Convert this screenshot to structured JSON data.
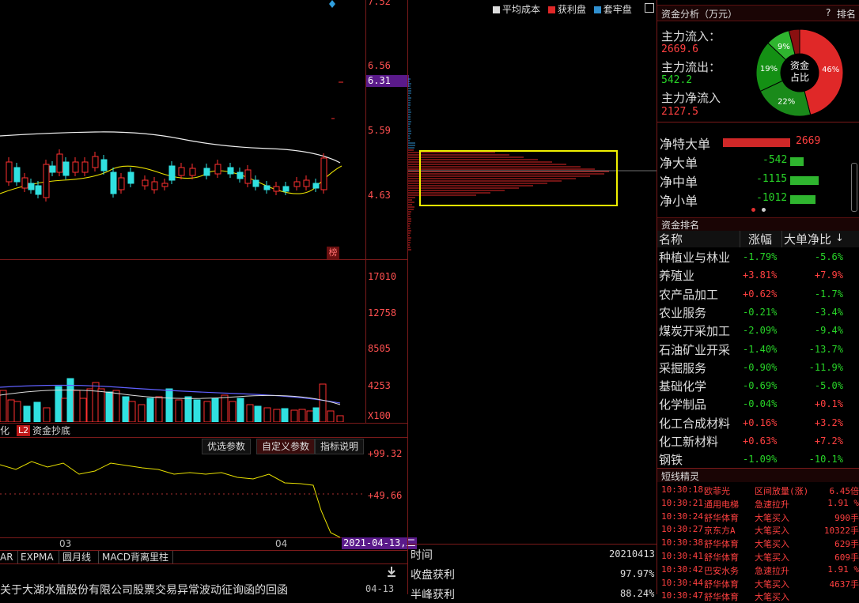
{
  "price_axis": [
    "7.52",
    "6.56",
    "6.31",
    "5.59",
    "4.63"
  ],
  "volume_axis": [
    "17010",
    "12758",
    "8505",
    "4253",
    "X100"
  ],
  "indicator_axis": [
    "+99.32",
    "+49.66"
  ],
  "month_labels": [
    "03",
    "04"
  ],
  "date_badge": "2021-04-13,二",
  "rank_badge": "榜",
  "indicator_tabs": {
    "prev": "化",
    "l2": "L2",
    "current": "资金抄底"
  },
  "param_buttons": {
    "preferred": "优选参数",
    "custom": "自定义参数",
    "explain": "指标说明"
  },
  "bottom_tabs": [
    "AR",
    "EXPMA",
    "圆月线",
    "MACD背离里柱"
  ],
  "news": {
    "title": "关于大湖水殖股份有限公司股票交易异常波动征询函的回函",
    "date": "04-13"
  },
  "chip": {
    "legend": {
      "avg_cost": "平均成本",
      "profit": "获利盘",
      "trapped": "套牢盘"
    },
    "time_label": "时间",
    "time_value": "20210413",
    "profit_label": "收盘获利",
    "profit_value": "97.97%",
    "next_label": "半峰获利",
    "next_value": "88.24%"
  },
  "fund": {
    "title": "资金分析（万元）",
    "help": "?",
    "rank_link": "排名",
    "inflow_label": "主力流入：",
    "inflow_value": "2669.6",
    "outflow_label": "主力流出：",
    "outflow_value": "542.2",
    "net_label": "主力净流入",
    "net_value": "2127.5",
    "donut_center": "资金\n占比",
    "donut_center_1": "资金",
    "donut_center_2": "占比",
    "pie": [
      {
        "label": "46%",
        "value": 46,
        "color": "#e02828"
      },
      {
        "label": "22%",
        "value": 22,
        "color": "#1a8a1a"
      },
      {
        "label": "19%",
        "value": 19,
        "color": "#149014"
      },
      {
        "label": "9%",
        "value": 9,
        "color": "#2fb52f"
      },
      {
        "label": "",
        "value": 4,
        "color": "#8a1010"
      }
    ]
  },
  "net_flow": [
    {
      "label": "净特大单",
      "value": "2669",
      "color": "#d02828",
      "bar": 1.0
    },
    {
      "label": "净大单",
      "value": "-542",
      "color": "#2fb52f",
      "bar": 0.2
    },
    {
      "label": "净中单",
      "value": "-1115",
      "color": "#2fb52f",
      "bar": 0.42
    },
    {
      "label": "净小单",
      "value": "-1012",
      "color": "#2fb52f",
      "bar": 0.38
    }
  ],
  "ranking": {
    "title": "资金排名",
    "headers": [
      "名称",
      "涨幅",
      "大单净比"
    ],
    "rows": [
      {
        "name": "种植业与林业",
        "chg": "-1.79%",
        "net": "-5.6%"
      },
      {
        "name": "养殖业",
        "chg": "+3.81%",
        "net": "+7.9%"
      },
      {
        "name": "农产品加工",
        "chg": "+0.62%",
        "net": "-1.7%"
      },
      {
        "name": "农业服务",
        "chg": "-0.21%",
        "net": "-3.4%"
      },
      {
        "name": "煤炭开采加工",
        "chg": "-2.09%",
        "net": "-9.4%"
      },
      {
        "name": "石油矿业开采",
        "chg": "-1.40%",
        "net": "-13.7%"
      },
      {
        "name": "采掘服务",
        "chg": "-0.90%",
        "net": "-11.9%"
      },
      {
        "name": "基础化学",
        "chg": "-0.69%",
        "net": "-5.0%"
      },
      {
        "name": "化学制品",
        "chg": "-0.04%",
        "net": "+0.1%"
      },
      {
        "name": "化工合成材料",
        "chg": "+0.16%",
        "net": "+3.2%"
      },
      {
        "name": "化工新材料",
        "chg": "+0.63%",
        "net": "+7.2%"
      },
      {
        "name": "钢铁",
        "chg": "-1.09%",
        "net": "-10.1%"
      }
    ]
  },
  "shortline": {
    "title": "短线精灵",
    "rows": [
      {
        "time": "10:30:18",
        "stock": "欧菲光",
        "event": "区间放量(涨)",
        "val": "6.45倍"
      },
      {
        "time": "10:30:21",
        "stock": "通用电梯",
        "event": "急速拉升",
        "val": "1.91 %"
      },
      {
        "time": "10:30:24",
        "stock": "舒华体育",
        "event": "大笔买入",
        "val": "990手"
      },
      {
        "time": "10:30:27",
        "stock": "京东方A",
        "event": "大笔买入",
        "val": "10322手"
      },
      {
        "time": "10:30:38",
        "stock": "舒华体育",
        "event": "大笔买入",
        "val": "629手"
      },
      {
        "time": "10:30:41",
        "stock": "舒华体育",
        "event": "大笔买入",
        "val": "609手"
      },
      {
        "time": "10:30:42",
        "stock": "巴安水务",
        "event": "急速拉升",
        "val": "1.91 %"
      },
      {
        "time": "10:30:44",
        "stock": "舒华体育",
        "event": "大笔买入",
        "val": "4637手"
      },
      {
        "time": "10:30:47",
        "stock": "舒华体育",
        "event": "大笔买入",
        "val": ""
      }
    ]
  }
}
